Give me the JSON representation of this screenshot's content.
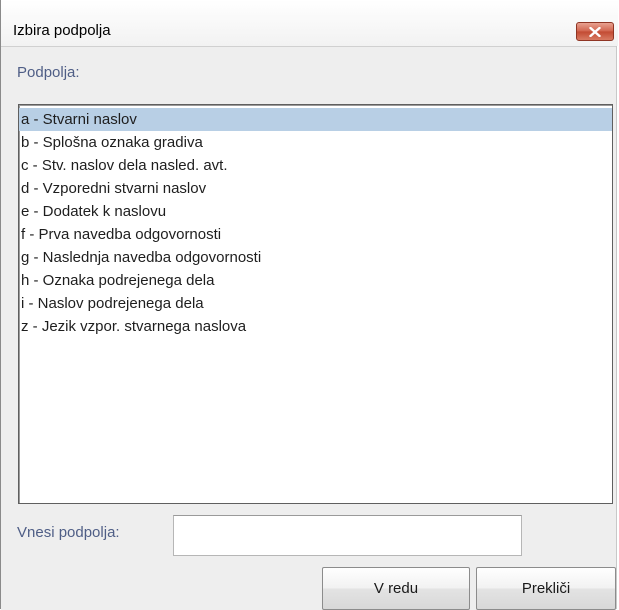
{
  "window": {
    "title": "Izbira podpolja",
    "close_icon": "close-icon"
  },
  "section_label": "Podpolja:",
  "list": {
    "selected_index": 0,
    "items": [
      "a - Stvarni naslov",
      "b - Splošna oznaka gradiva",
      "c - Stv. naslov dela nasled. avt.",
      "d - Vzporedni stvarni naslov",
      "e - Dodatek k naslovu",
      "f - Prva navedba odgovornosti",
      "g - Naslednja navedba odgovornosti",
      "h - Oznaka podrejenega dela",
      "i - Naslov podrejenega dela",
      "z - Jezik vzpor. stvarnega naslova"
    ]
  },
  "input": {
    "label": "Vnesi podpolja:",
    "value": "",
    "placeholder": ""
  },
  "buttons": {
    "ok": "V redu",
    "cancel": "Prekliči"
  },
  "colors": {
    "selection": "#b8cfe5",
    "label_text": "#4f5e86",
    "close_button": "#c8553e"
  }
}
